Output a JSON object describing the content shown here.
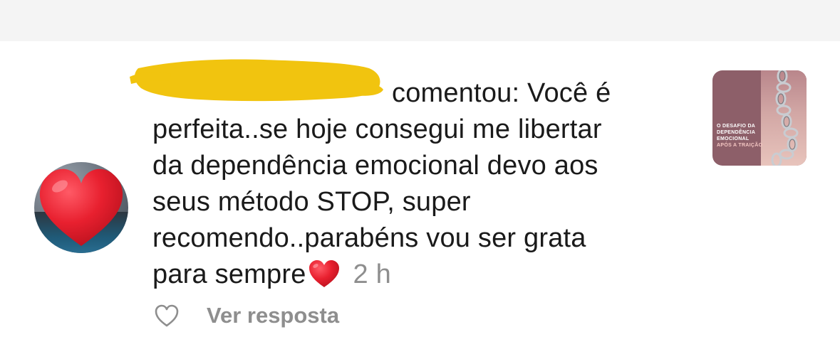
{
  "notification": {
    "comment_lines": [
      "comentou: Você é",
      "perfeita..se hoje consegui me libertar",
      "da dependência emocional devo aos",
      "seus método STOP, super",
      "recomendo..parabéns vou ser grata",
      "para sempre"
    ],
    "time": "2 h",
    "reply_label": "Ver resposta",
    "heart_emoji": "❤️",
    "like_icon": "heart-outline-icon"
  },
  "post_thumbnail": {
    "lines": [
      "O DESAFIO DA",
      "DEPENDÊNCIA",
      "EMOCIONAL",
      "APÓS A TRAIÇÃO"
    ]
  },
  "colors": {
    "text": "#1a1a1a",
    "muted": "#8e8e8e",
    "redaction": "#f1c40f",
    "heart": "#e0202f",
    "top_bar": "#f4f4f4",
    "thumbnail_bg": "#8d5f69"
  }
}
